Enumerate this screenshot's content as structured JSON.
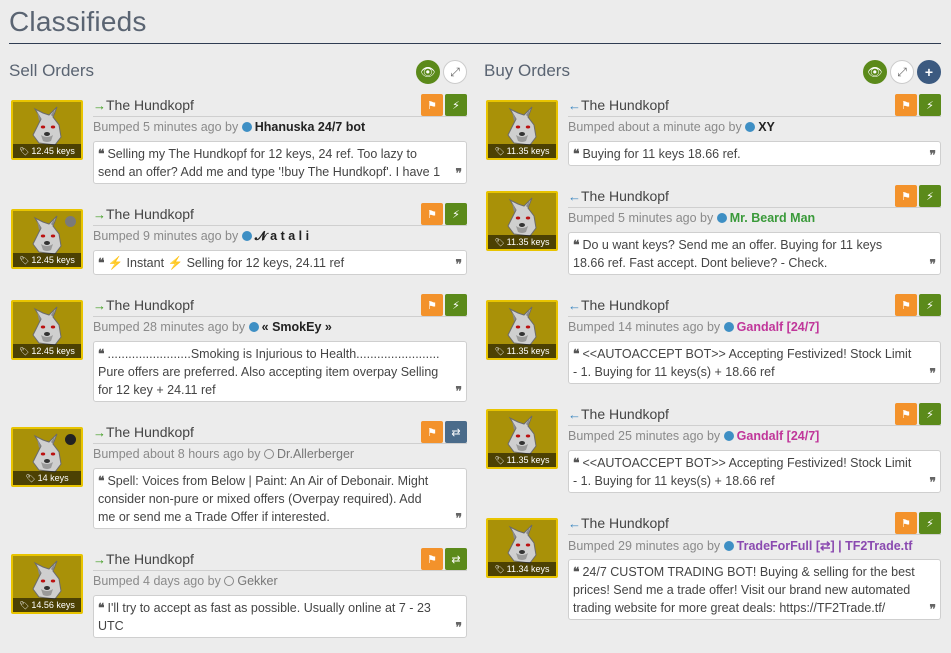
{
  "page": {
    "title": "Classifieds"
  },
  "sell": {
    "title": "Sell Orders",
    "tools": {
      "toggle_icon": "eye-icon",
      "expand_icon": "expand-icon"
    },
    "listings": [
      {
        "item_name": "The Hundkopf",
        "price": "12.45 keys",
        "bumped": "Bumped 5 minutes ago by",
        "user": "Hhanuska 24/7 bot",
        "user_status": "online",
        "user_color": "#222222",
        "comment": "Selling my The Hundkopf for 12 keys, 24 ref. Too lazy to send an offer? Add me and type '!buy The Hundkopf'. I have 1",
        "action": "bolt",
        "effect": "",
        "lines": 2
      },
      {
        "item_name": "The Hundkopf",
        "price": "12.45 keys",
        "bumped": "Bumped 9 minutes ago by",
        "user": "𝓝 a t a l i",
        "user_status": "online",
        "user_color": "#222222",
        "comment": "Instant ⚡ Selling for 12 keys, 24.11 ref",
        "comment_prefix": "⚡",
        "action": "bolt",
        "effect": "#7a7a7a",
        "lines": 1
      },
      {
        "item_name": "The Hundkopf",
        "price": "12.45 keys",
        "bumped": "Bumped 28 minutes ago by",
        "user": "« SmokEy »",
        "user_status": "online",
        "user_color": "#222222",
        "comment": "........................Smoking is Injurious to Health........................ Pure offers are preferred. Also accepting item overpay Selling for 12 key + 24.11 ref",
        "action": "bolt",
        "effect": "",
        "lines": 3
      },
      {
        "item_name": "The Hundkopf",
        "price": "14 keys",
        "bumped": "Bumped about 8 hours ago by",
        "user": "Dr.Allerberger",
        "user_status": "offline",
        "user_color": "#777777",
        "comment": "Spell: Voices from Below | Paint: An Air of Debonair. Might consider non-pure or mixed offers (Overpay required). Add me or send me a Trade Offer if interested.",
        "action": "trade",
        "effect": "#222222",
        "lines": 3
      },
      {
        "item_name": "The Hundkopf",
        "price": "14.56 keys",
        "bumped": "Bumped 4 days ago by",
        "user": "Gekker",
        "user_status": "offline",
        "user_color": "#777777",
        "comment": "I'll try to accept as fast as possible. Usually online at 7 - 23 UTC",
        "action": "trade-green",
        "effect": "",
        "lines": 2
      }
    ]
  },
  "buy": {
    "title": "Buy Orders",
    "tools": {
      "toggle_icon": "eye-icon",
      "expand_icon": "expand-icon",
      "add_icon": "plus-icon"
    },
    "listings": [
      {
        "item_name": "The Hundkopf",
        "price": "11.35 keys",
        "bumped": "Bumped about a minute ago by",
        "user": "XY",
        "user_status": "online",
        "user_color": "#222222",
        "comment": "Buying for 11 keys 18.66 ref.",
        "action": "bolt",
        "lines": 1
      },
      {
        "item_name": "The Hundkopf",
        "price": "11.35 keys",
        "bumped": "Bumped 5 minutes ago by",
        "user": "Mr. Beard Man",
        "user_status": "online",
        "user_color": "#3a9a3a",
        "comment": "Do u want keys? Send me an offer. Buying for 11 keys 18.66 ref. Fast accept. Dont believe? - Check.",
        "action": "bolt",
        "lines": 2
      },
      {
        "item_name": "The Hundkopf",
        "price": "11.35 keys",
        "bumped": "Bumped 14 minutes ago by",
        "user": "Gandalf [24/7]",
        "user_status": "online",
        "user_color": "#c0369a",
        "comment": "<<AUTOACCEPT BOT>> Accepting Festivized! Stock Limit - 1. Buying for 11 keys(s) + 18.66 ref",
        "action": "bolt",
        "lines": 2
      },
      {
        "item_name": "The Hundkopf",
        "price": "11.35 keys",
        "bumped": "Bumped 25 minutes ago by",
        "user": "Gandalf [24/7]",
        "user_status": "online",
        "user_color": "#c0369a",
        "comment": "<<AUTOACCEPT BOT>> Accepting Festivized! Stock Limit - 1. Buying for 11 keys(s) + 18.66 ref",
        "action": "bolt",
        "lines": 2
      },
      {
        "item_name": "The Hundkopf",
        "price": "11.34 keys",
        "bumped": "Bumped 29 minutes ago by",
        "user": "TradeForFull [⇄] | TF2Trade.tf",
        "user_status": "online",
        "user_color": "#8a4ab0",
        "comment": "24/7 CUSTOM TRADING BOT! Buying & selling for the best prices! Send me a trade offer! Visit our brand new automated trading website for more great deals: https://TF2Trade.tf/",
        "action": "bolt",
        "lines": 3
      }
    ]
  }
}
